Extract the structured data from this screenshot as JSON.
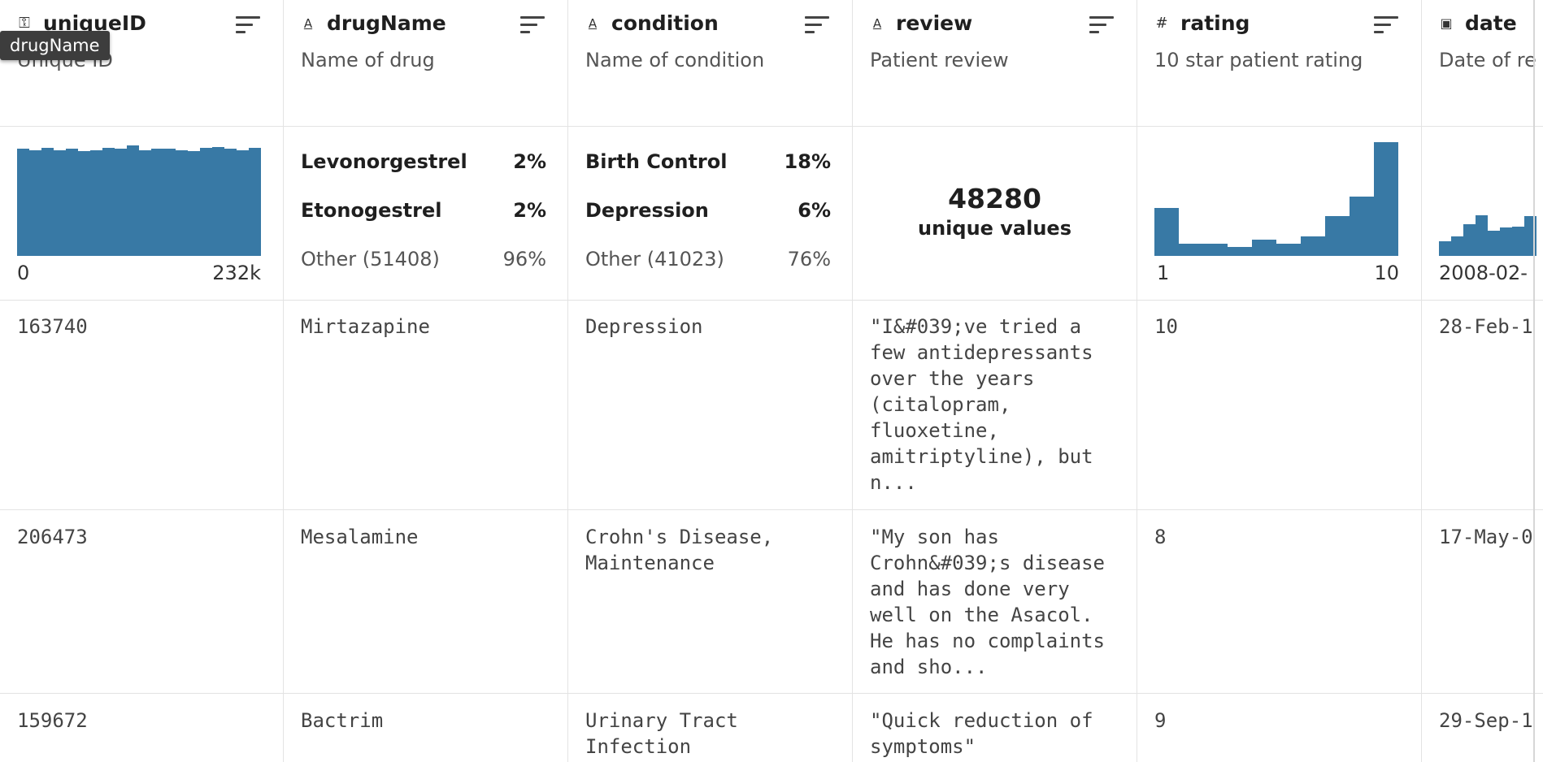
{
  "tooltip": "drugName",
  "columns": [
    {
      "name": "uniqueID",
      "type_icon": "key",
      "icon_glyph": "⚿",
      "description": "Unique ID",
      "axis_min": "0",
      "axis_max": "232k",
      "histogram": [
        0.94,
        0.93,
        0.95,
        0.93,
        0.94,
        0.92,
        0.93,
        0.95,
        0.94,
        0.97,
        0.93,
        0.94,
        0.94,
        0.93,
        0.92,
        0.95,
        0.96,
        0.94,
        0.93,
        0.95
      ]
    },
    {
      "name": "drugName",
      "type_icon": "text",
      "icon_glyph": "A",
      "description": "Name of drug",
      "top": [
        {
          "label": "Levonorgestrel",
          "pct": "2%"
        },
        {
          "label": "Etonogestrel",
          "pct": "2%"
        }
      ],
      "other": {
        "label": "Other (51408)",
        "pct": "96%"
      }
    },
    {
      "name": "condition",
      "type_icon": "text",
      "icon_glyph": "A",
      "description": "Name of condition",
      "top": [
        {
          "label": "Birth Control",
          "pct": "18%"
        },
        {
          "label": "Depression",
          "pct": "6%"
        }
      ],
      "other": {
        "label": "Other (41023)",
        "pct": "76%"
      }
    },
    {
      "name": "review",
      "type_icon": "text",
      "icon_glyph": "A",
      "description": "Patient review",
      "unique_count": "48280",
      "unique_label": "unique values"
    },
    {
      "name": "rating",
      "type_icon": "number",
      "icon_glyph": "#",
      "description": "10 star patient rating",
      "axis_min": "1",
      "axis_max": "10",
      "histogram": [
        0.42,
        0.11,
        0.11,
        0.08,
        0.14,
        0.11,
        0.17,
        0.35,
        0.52,
        1.0
      ]
    },
    {
      "name": "date",
      "type_icon": "calendar",
      "icon_glyph": "▣",
      "description": "Date of re",
      "axis_min": "2008-02-",
      "histogram": [
        0.13,
        0.17,
        0.28,
        0.36,
        0.22,
        0.25,
        0.26,
        0.35
      ]
    }
  ],
  "rows": [
    {
      "uniqueID": "163740",
      "drugName": "Mirtazapine",
      "condition": "Depression",
      "review": "\"I&#039;ve tried a few antidepressants over the years (citalopram, fluoxetine, amitriptyline), but n...",
      "rating": "10",
      "date": "28-Feb-1"
    },
    {
      "uniqueID": "206473",
      "drugName": "Mesalamine",
      "condition": "Crohn's Disease, Maintenance",
      "review": "\"My son has Crohn&#039;s disease and has done very well on the Asacol. He has no complaints and sho...",
      "rating": "8",
      "date": "17-May-0"
    },
    {
      "uniqueID": "159672",
      "drugName": "Bactrim",
      "condition": "Urinary Tract Infection",
      "review": "\"Quick reduction of symptoms\"",
      "rating": "9",
      "date": "29-Sep-1"
    }
  ],
  "colors": {
    "bar": "#3879a5",
    "border": "#e3e3e3"
  }
}
